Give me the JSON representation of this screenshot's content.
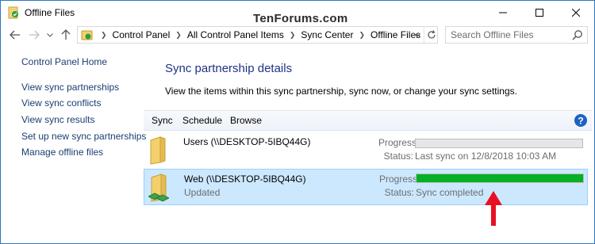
{
  "window": {
    "title": "Offline Files",
    "watermark": "TenForums.com"
  },
  "address": {
    "crumbs": [
      "Control Panel",
      "All Control Panel Items",
      "Sync Center",
      "Offline Files"
    ]
  },
  "search": {
    "placeholder": "Search Offline Files"
  },
  "left_pane": {
    "home": "Control Panel Home",
    "links": [
      "View sync partnerships",
      "View sync conflicts",
      "View sync results",
      "Set up new sync partnerships",
      "Manage offline files"
    ]
  },
  "main": {
    "title": "Sync partnership details",
    "description": "View the items within this sync partnership, sync now, or change your sync settings."
  },
  "toolbar": {
    "sync": "Sync",
    "schedule": "Schedule",
    "browse": "Browse"
  },
  "items": [
    {
      "name": "Users (\\\\DESKTOP-5IBQ44G)",
      "subtitle": "",
      "progress_label": "Progress:",
      "progress": 0,
      "status_label": "Status:",
      "status": "Last sync on 12/8/2018 10:03 AM",
      "selected": false
    },
    {
      "name": "Web (\\\\DESKTOP-5IBQ44G)",
      "subtitle": "Updated",
      "progress_label": "Progress:",
      "progress": 1.0,
      "status_label": "Status:",
      "status": "Sync completed",
      "selected": true
    }
  ],
  "colors": {
    "progress_fill": "#06b025",
    "selection": "#cce8ff",
    "annotation_arrow": "#e81123",
    "link": "#1a3e72",
    "title": "#1e3287"
  }
}
